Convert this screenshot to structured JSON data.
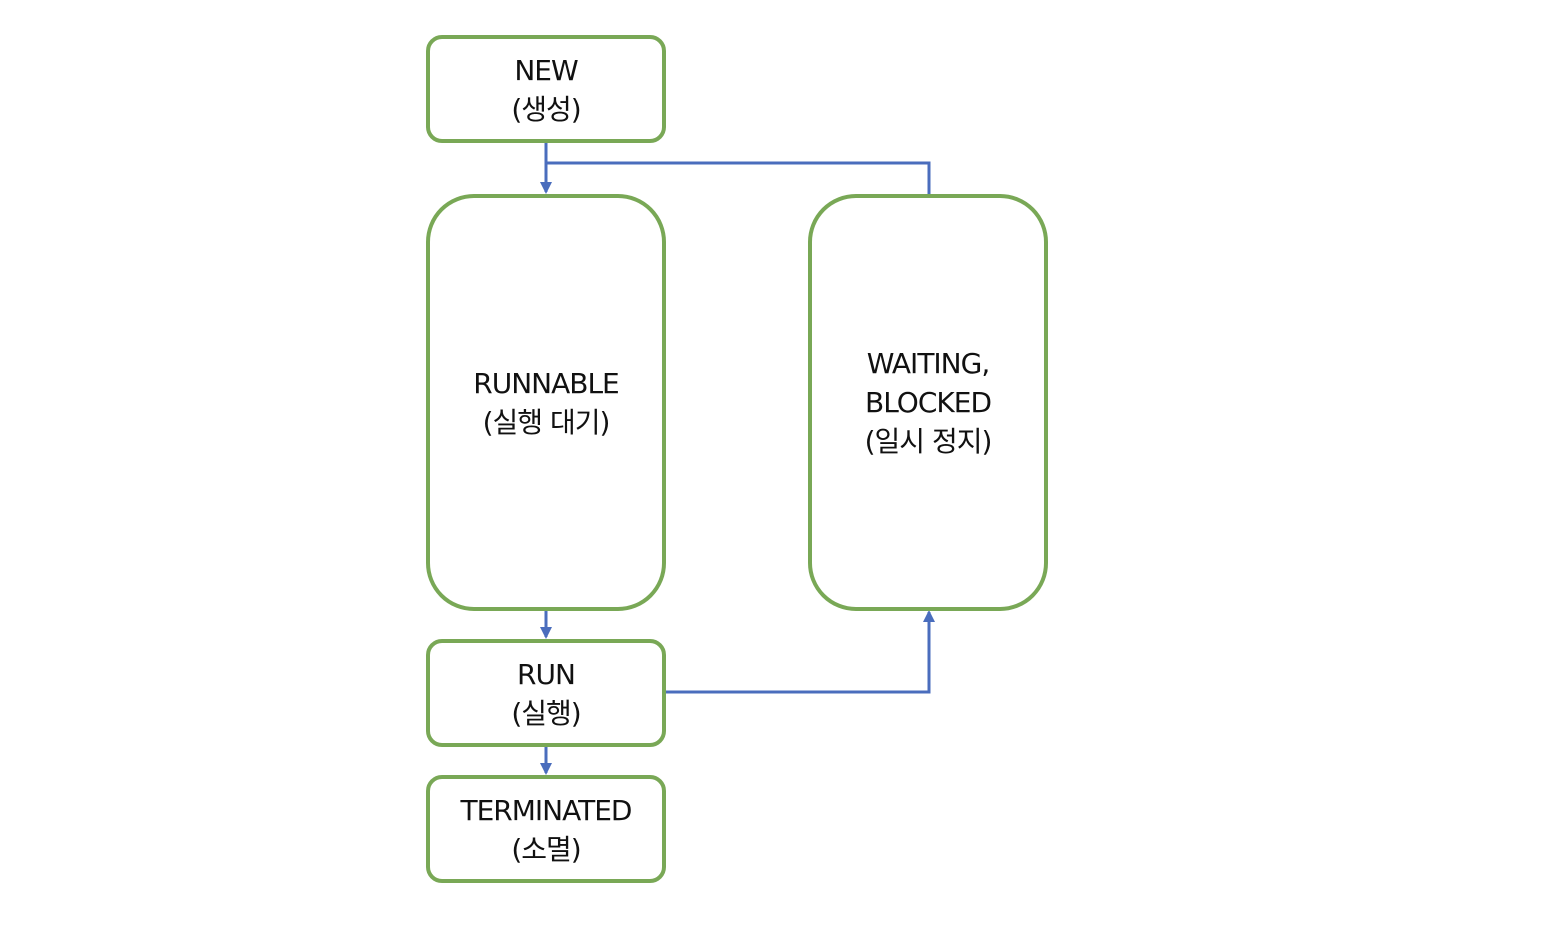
{
  "diagram": {
    "type": "state-flow",
    "colors": {
      "box_border": "#79A856",
      "arrow": "#4A6DBD",
      "text": "#111111",
      "background": "#FFFFFF"
    },
    "nodes": {
      "new": {
        "line1": "NEW",
        "line2": "(생성)"
      },
      "runnable": {
        "line1": "RUNNABLE",
        "line2": "(실행 대기)"
      },
      "waiting": {
        "line1": "WAITING,",
        "line2": "BLOCKED",
        "line3": "(일시 정지)"
      },
      "run": {
        "line1": "RUN",
        "line2": "(실행)"
      },
      "terminated": {
        "line1": "TERMINATED",
        "line2": "(소멸)"
      }
    },
    "edges": [
      {
        "from": "new",
        "to": "runnable"
      },
      {
        "from": "waiting",
        "to": "runnable"
      },
      {
        "from": "runnable",
        "to": "run"
      },
      {
        "from": "run",
        "to": "waiting"
      },
      {
        "from": "run",
        "to": "terminated"
      }
    ]
  }
}
